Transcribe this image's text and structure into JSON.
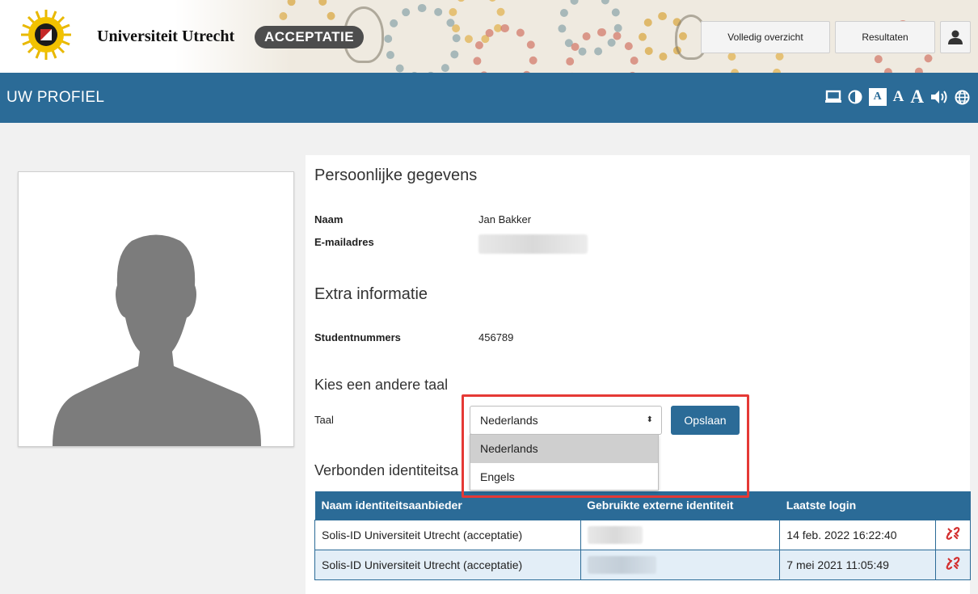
{
  "header": {
    "brand": "Universiteit Utrecht",
    "environment_badge": "ACCEPTATIE",
    "buttons": {
      "overview": "Volledig overzicht",
      "results": "Resultaten",
      "user_icon": "user-icon"
    }
  },
  "titlebar": {
    "title": "UW PROFIEL",
    "accessibility_icons": [
      "desktop-icon",
      "contrast-icon",
      "font-small-icon",
      "font-medium-icon",
      "font-large-icon",
      "speaker-icon",
      "globe-icon"
    ],
    "font_label": "A"
  },
  "profile": {
    "photo_icon": "person-silhouette-icon"
  },
  "personal": {
    "heading": "Persoonlijke gegevens",
    "name_label": "Naam",
    "name_value": "Jan Bakker",
    "email_label": "E-mailadres"
  },
  "extra": {
    "heading": "Extra informatie",
    "student_label": "Studentnummers",
    "student_value": "456789"
  },
  "language": {
    "heading": "Kies een andere taal",
    "label": "Taal",
    "selected": "Nederlands",
    "save_label": "Opslaan",
    "options": [
      "Nederlands",
      "Engels"
    ]
  },
  "identities": {
    "heading": "Verbonden identiteitsa",
    "columns": [
      "Naam identiteitsaanbieder",
      "Gebruikte externe identiteit",
      "Laatste login"
    ],
    "rows": [
      {
        "provider": "Solis-ID Universiteit Utrecht (acceptatie)",
        "last_login": "14 feb. 2022 16:22:40"
      },
      {
        "provider": "Solis-ID Universiteit Utrecht (acceptatie)",
        "last_login": "7 mei 2021 11:05:49"
      }
    ]
  },
  "colors": {
    "brand_blue": "#2b6b97",
    "highlight": "#e53935",
    "unlink": "#d32f2f"
  }
}
